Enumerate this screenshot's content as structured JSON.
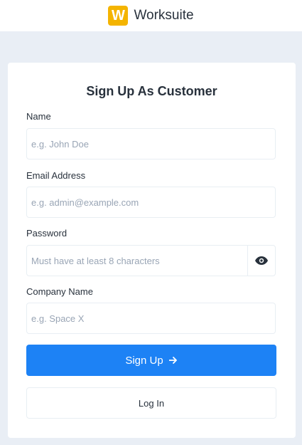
{
  "header": {
    "logo_letter": "W",
    "brand": "Worksuite",
    "logo_color": "#f4b400"
  },
  "form": {
    "title": "Sign Up As Customer",
    "name": {
      "label": "Name",
      "placeholder": "e.g. John Doe"
    },
    "email": {
      "label": "Email Address",
      "placeholder": "e.g. admin@example.com"
    },
    "password": {
      "label": "Password",
      "placeholder": "Must have at least 8 characters",
      "toggle_icon": "eye-icon"
    },
    "company": {
      "label": "Company Name",
      "placeholder": "e.g. Space X"
    },
    "signup_label": "Sign Up",
    "signup_icon": "arrow-right-icon",
    "login_label": "Log In",
    "accent_color": "#1d82f5"
  }
}
